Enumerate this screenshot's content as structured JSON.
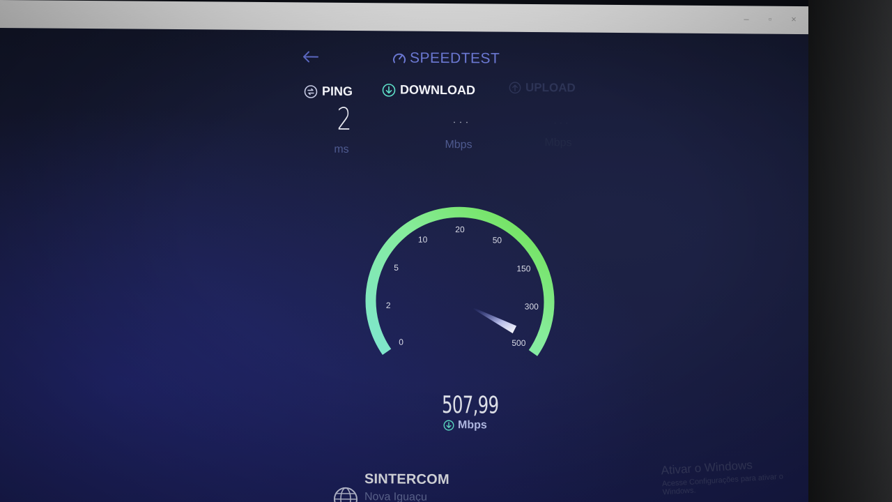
{
  "header": {
    "back_icon": "back-arrow-icon",
    "logo_icon": "gauge-logo-icon",
    "app_title": "SPEEDTEST"
  },
  "stats": {
    "ping": {
      "label": "PING",
      "icon": "ping-icon",
      "value": "2",
      "unit": "ms"
    },
    "download": {
      "label": "DOWNLOAD",
      "icon": "download-arrow-icon",
      "value": "...",
      "unit": "Mbps"
    },
    "upload": {
      "label": "UPLOAD",
      "icon": "upload-arrow-icon",
      "value": "...",
      "unit": "Mbps"
    }
  },
  "gauge": {
    "ticks": [
      "0",
      "2",
      "5",
      "10",
      "20",
      "50",
      "150",
      "300",
      "500"
    ],
    "reading": "507,99",
    "reading_unit": "Mbps",
    "needle_value": 507.99,
    "arc_color_start": "#7fe6cf",
    "arc_color_end": "#6fe04f"
  },
  "server": {
    "icon": "globe-icon",
    "isp_name": "SINTERCOM",
    "location": "Nova Iguaçu"
  },
  "watermark": {
    "line1": "Ativar o Windows",
    "line2": "Acesse Configurações para ativar o Windows."
  },
  "colors": {
    "accent": "#6d7ad6",
    "background": "#181c3c"
  }
}
